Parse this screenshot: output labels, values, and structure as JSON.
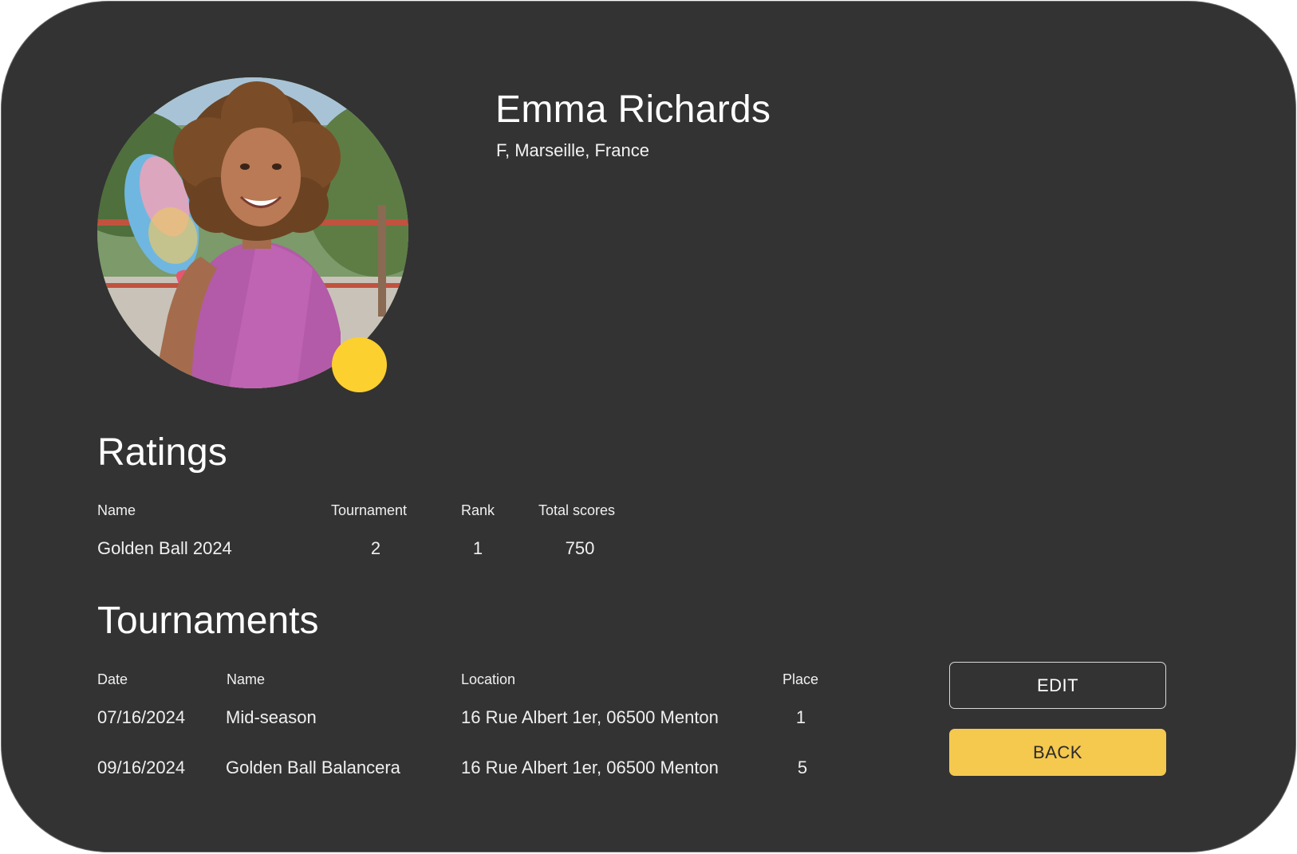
{
  "profile": {
    "name": "Emma Richards",
    "subtitle": "F, Marseille, France",
    "avatar_icon": "player-photo",
    "status_color": "#FCD02E"
  },
  "ratings": {
    "title": "Ratings",
    "columns": {
      "name": "Name",
      "tournament": "Tournament",
      "rank": "Rank",
      "total": "Total scores"
    },
    "rows": [
      {
        "name": "Golden Ball  2024",
        "tournament": "2",
        "rank": "1",
        "total": "750"
      }
    ]
  },
  "tournaments": {
    "title": "Tournaments",
    "columns": {
      "date": "Date",
      "name": "Name",
      "location": "Location",
      "place": "Place"
    },
    "rows": [
      {
        "date": "07/16/2024",
        "name": "Mid-season",
        "location": "16 Rue Albert 1er, 06500 Menton",
        "place": "1"
      },
      {
        "date": "09/16/2024",
        "name": "Golden Ball Balancera",
        "location": "16 Rue Albert 1er, 06500 Menton",
        "place": "5"
      }
    ]
  },
  "actions": {
    "edit_label": "EDIT",
    "back_label": "BACK",
    "back_color": "#F5C84E"
  }
}
